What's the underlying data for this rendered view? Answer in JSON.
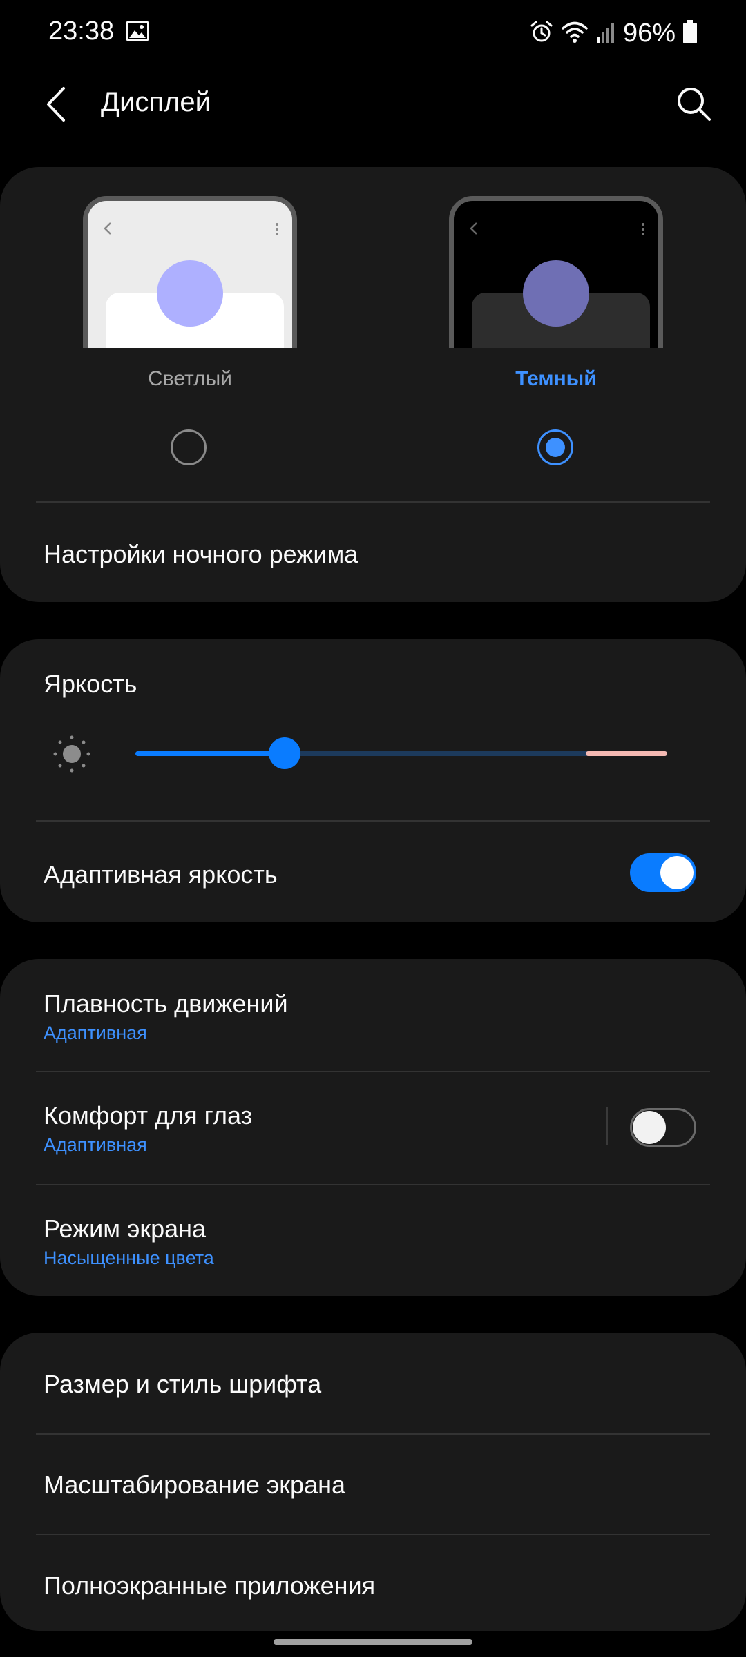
{
  "status_bar": {
    "time": "23:38",
    "battery_percent": "96%",
    "icons": [
      "image-icon",
      "alarm-icon",
      "wifi-icon",
      "signal-icon",
      "battery-icon"
    ]
  },
  "header": {
    "title": "Дисплей",
    "back_icon": "chevron-left-icon",
    "search_icon": "search-icon"
  },
  "theme": {
    "light_label": "Светлый",
    "dark_label": "Темный",
    "selected": "dark",
    "night_mode_settings": "Настройки ночного режима"
  },
  "brightness": {
    "title": "Яркость",
    "level": 0.28,
    "adaptive_label": "Адаптивная яркость",
    "adaptive_on": true
  },
  "motion": {
    "title": "Плавность движений",
    "value": "Адаптивная"
  },
  "eye_comfort": {
    "title": "Комфорт для глаз",
    "value": "Адаптивная",
    "on": false
  },
  "screen_mode": {
    "title": "Режим экрана",
    "value": "Насыщенные цвета"
  },
  "fonts": {
    "font_size_style": "Размер и стиль шрифта",
    "screen_zoom": "Масштабирование экрана",
    "fullscreen_apps": "Полноэкранные приложения"
  },
  "colors": {
    "accent": "#3e91ff",
    "toggle_on": "#0a7cff",
    "card_bg": "#1a1a1a",
    "slider_track": "#1c3a5c",
    "slider_high": "#f4b9b2"
  }
}
